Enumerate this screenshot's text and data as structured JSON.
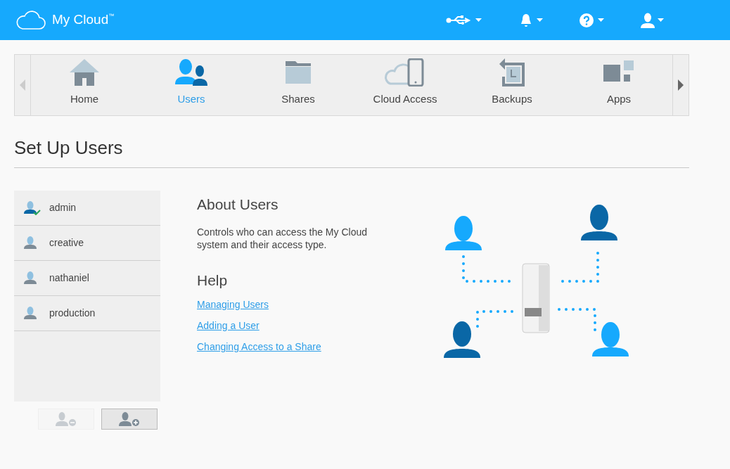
{
  "header": {
    "title": "My Cloud",
    "trademark": "™"
  },
  "nav": {
    "tabs": [
      {
        "label": "Home",
        "selected": false
      },
      {
        "label": "Users",
        "selected": true
      },
      {
        "label": "Shares",
        "selected": false
      },
      {
        "label": "Cloud Access",
        "selected": false
      },
      {
        "label": "Backups",
        "selected": false
      },
      {
        "label": "Apps",
        "selected": false
      }
    ]
  },
  "page_title": "Set Up Users",
  "users": [
    {
      "name": "admin",
      "admin": true
    },
    {
      "name": "creative",
      "admin": false
    },
    {
      "name": "nathaniel",
      "admin": false
    },
    {
      "name": "production",
      "admin": false
    }
  ],
  "user_buttons": [
    {
      "kind": "remove",
      "disabled": true
    },
    {
      "kind": "add",
      "disabled": false
    }
  ],
  "about": {
    "title": "About Users",
    "text": "Controls who can access the My Cloud system and their access type."
  },
  "help": {
    "title": "Help",
    "links": [
      "Managing Users",
      "Adding a User",
      "Changing Access to a Share"
    ]
  }
}
